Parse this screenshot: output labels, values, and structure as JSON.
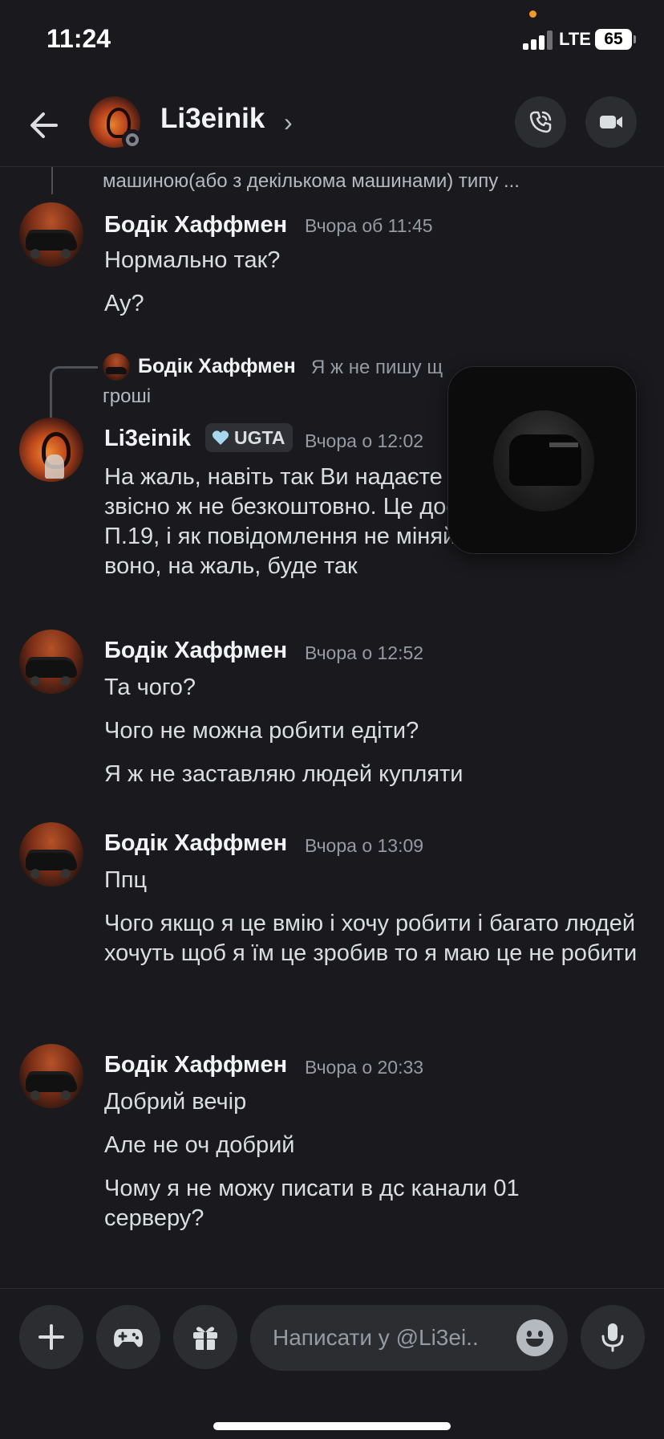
{
  "status_bar": {
    "time": "11:24",
    "network": "LTE",
    "battery": "65"
  },
  "header": {
    "name": "Li3einik",
    "chevron": "›"
  },
  "reply_top": {
    "text": "машиною(або з декількома машинами) типу ..."
  },
  "reply_preview": {
    "author": "Бодік Хаффмен",
    "text": "Я ж не пишу щ",
    "text_line2": "гроші"
  },
  "messages": [
    {
      "author": "Бодік Хаффмен",
      "timestamp": "Вчора об 11:45",
      "lines": [
        "Нормально так?",
        "Ау?"
      ]
    },
    {
      "author": "Li3einik",
      "badge": "UGTA",
      "timestamp": "Вчора о 12:02",
      "lines": [
        "На жаль, навіть так Ви надаєте певну послугу, і звісно ж не безкоштовно. Це досі порушує П.19, і як повідомлення не міняйте, все одно воно, на жаль, буде так"
      ]
    },
    {
      "author": "Бодік Хаффмен",
      "timestamp": "Вчора о 12:52",
      "lines": [
        "Та чого?",
        "Чого не можна робити едіти?",
        "Я ж не заставляю людей купляти"
      ]
    },
    {
      "author": "Бодік Хаффмен",
      "timestamp": "Вчора о 13:09",
      "lines": [
        "Ппц",
        "Чого якщо я це вмію і хочу робити і багато людей хочуть щоб я їм це зробив то я маю це не робити"
      ]
    },
    {
      "author": "Бодік Хаффмен",
      "timestamp": "Вчора о 20:33",
      "lines": [
        "Добрий вечір",
        "Але не оч добрий",
        "Чому я не можу писати в дс канали 01 серверу?"
      ]
    }
  ],
  "composer": {
    "placeholder": "Написати у @Li3ei.."
  },
  "icons": {
    "back": "arrow-left-icon",
    "call": "phone-icon",
    "video": "video-camera-icon",
    "plus": "plus-icon",
    "game": "gamepad-icon",
    "gift": "gift-icon",
    "emoji": "emoji-icon",
    "mic": "microphone-icon"
  },
  "colors": {
    "background": "#1a1a1e",
    "badge_heart": "#a9d8ec",
    "status_dot": "#f09a2a"
  }
}
